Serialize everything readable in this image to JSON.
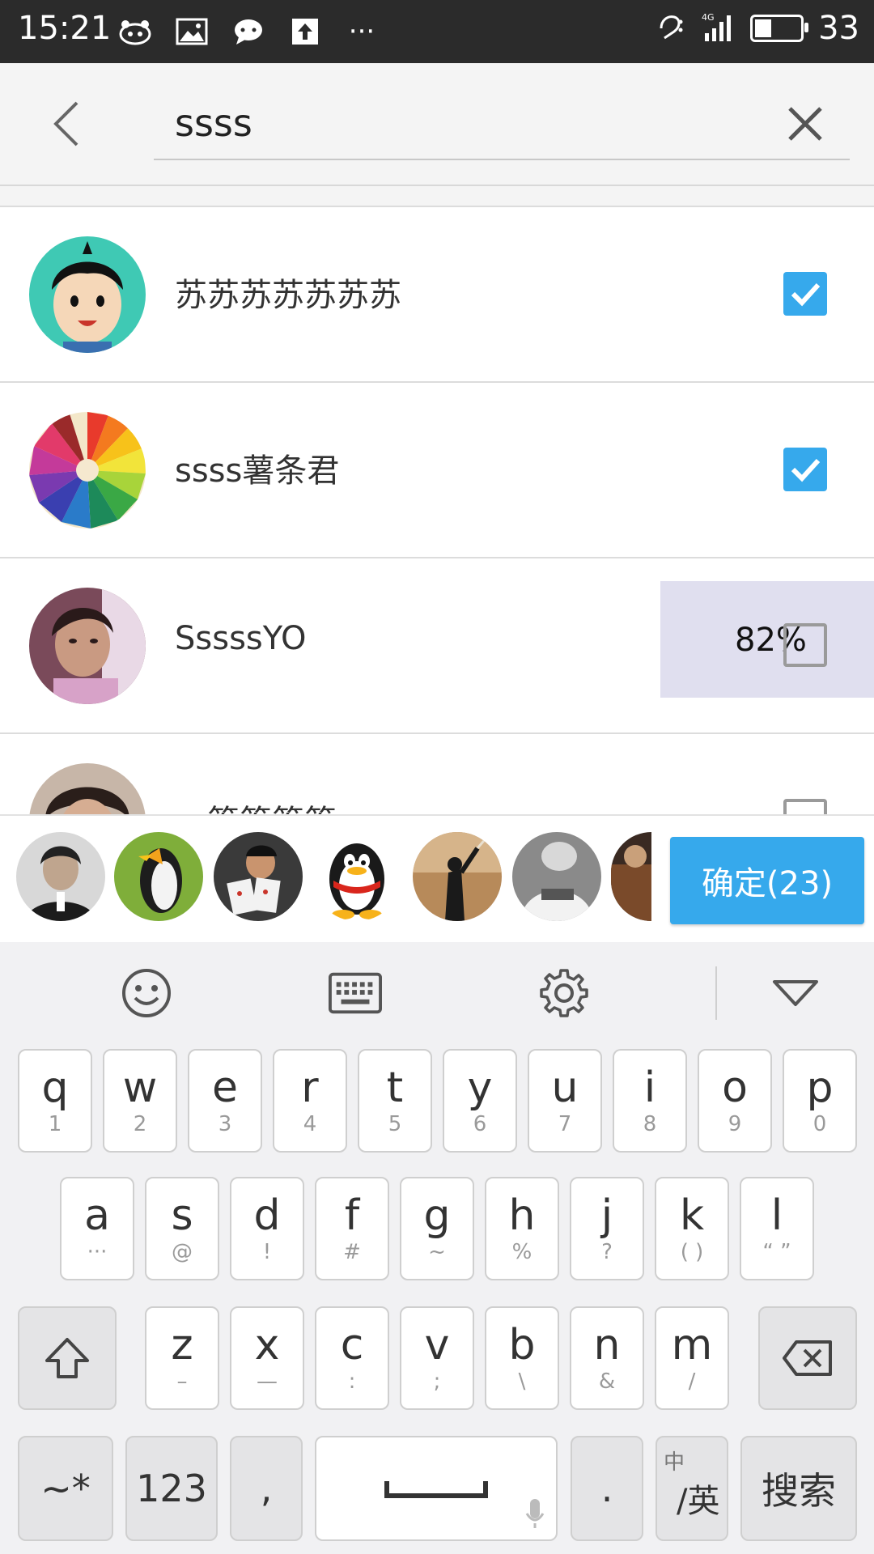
{
  "status": {
    "time": "15:21",
    "battery": "33",
    "network": "4G",
    "more": "···"
  },
  "header": {
    "search_value": "ssss"
  },
  "contacts": [
    {
      "name": "苏苏苏苏苏苏苏",
      "checked": true
    },
    {
      "name": "ssss薯条君",
      "checked": true
    },
    {
      "name": "SssssYO",
      "checked": false,
      "progress": "82%"
    },
    {
      "name": "篁篁篁篁",
      "checked": false
    }
  ],
  "selected_bar": {
    "confirm_label": "确定(23)"
  },
  "keyboard": {
    "row1": [
      {
        "k": "q",
        "s": "1"
      },
      {
        "k": "w",
        "s": "2"
      },
      {
        "k": "e",
        "s": "3"
      },
      {
        "k": "r",
        "s": "4"
      },
      {
        "k": "t",
        "s": "5"
      },
      {
        "k": "y",
        "s": "6"
      },
      {
        "k": "u",
        "s": "7"
      },
      {
        "k": "i",
        "s": "8"
      },
      {
        "k": "o",
        "s": "9"
      },
      {
        "k": "p",
        "s": "0"
      }
    ],
    "row2": [
      {
        "k": "a",
        "s": "···"
      },
      {
        "k": "s",
        "s": "@"
      },
      {
        "k": "d",
        "s": "!"
      },
      {
        "k": "f",
        "s": "#"
      },
      {
        "k": "g",
        "s": "~"
      },
      {
        "k": "h",
        "s": "%"
      },
      {
        "k": "j",
        "s": "?"
      },
      {
        "k": "k",
        "s": "( )"
      },
      {
        "k": "l",
        "s": "“ ”"
      }
    ],
    "row3": [
      {
        "k": "z",
        "s": "–"
      },
      {
        "k": "x",
        "s": "—"
      },
      {
        "k": "c",
        "s": ":"
      },
      {
        "k": "v",
        "s": ";"
      },
      {
        "k": "b",
        "s": "\\"
      },
      {
        "k": "n",
        "s": "&"
      },
      {
        "k": "m",
        "s": "/"
      }
    ],
    "bottom": {
      "symbols": "~*",
      "numbers": "123",
      "comma": ",",
      "period": ".",
      "lang_small": "中",
      "lang_big": "/英",
      "search": "搜索"
    }
  }
}
